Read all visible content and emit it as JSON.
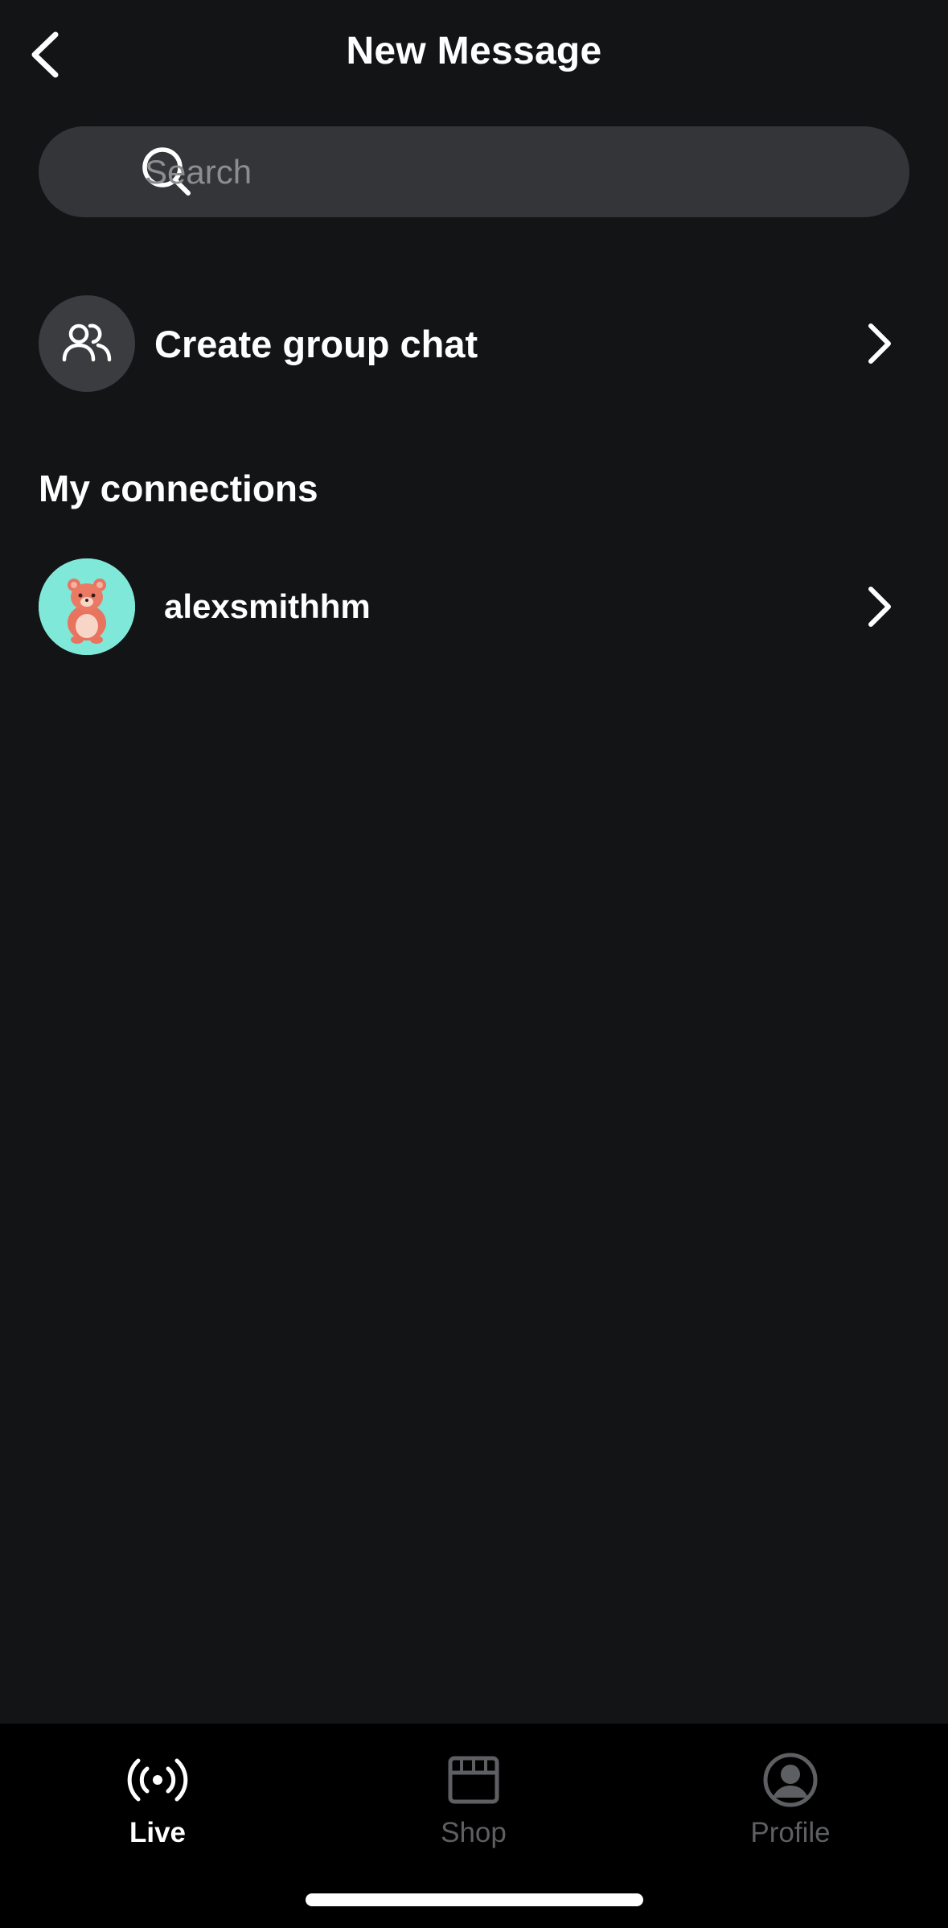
{
  "header": {
    "title": "New Message",
    "back_icon": "chevron-left-icon"
  },
  "search": {
    "placeholder": "Search",
    "value": "",
    "icon": "search-icon"
  },
  "group_chat": {
    "label": "Create group chat",
    "icon": "users-icon"
  },
  "connections": {
    "section_title": "My connections",
    "items": [
      {
        "username": "alexsmithhm",
        "avatar": "bear-avatar"
      }
    ]
  },
  "bottom_nav": {
    "items": [
      {
        "label": "Live",
        "icon": "live-broadcast-icon",
        "active": true
      },
      {
        "label": "Shop",
        "icon": "storefront-icon",
        "active": false
      },
      {
        "label": "Profile",
        "icon": "user-circle-icon",
        "active": false
      }
    ]
  },
  "colors": {
    "background": "#131416",
    "search_bg": "#343538",
    "avatar_bg": "#7fe8d9",
    "nav_bg": "#000000",
    "inactive": "#5e5f62"
  }
}
